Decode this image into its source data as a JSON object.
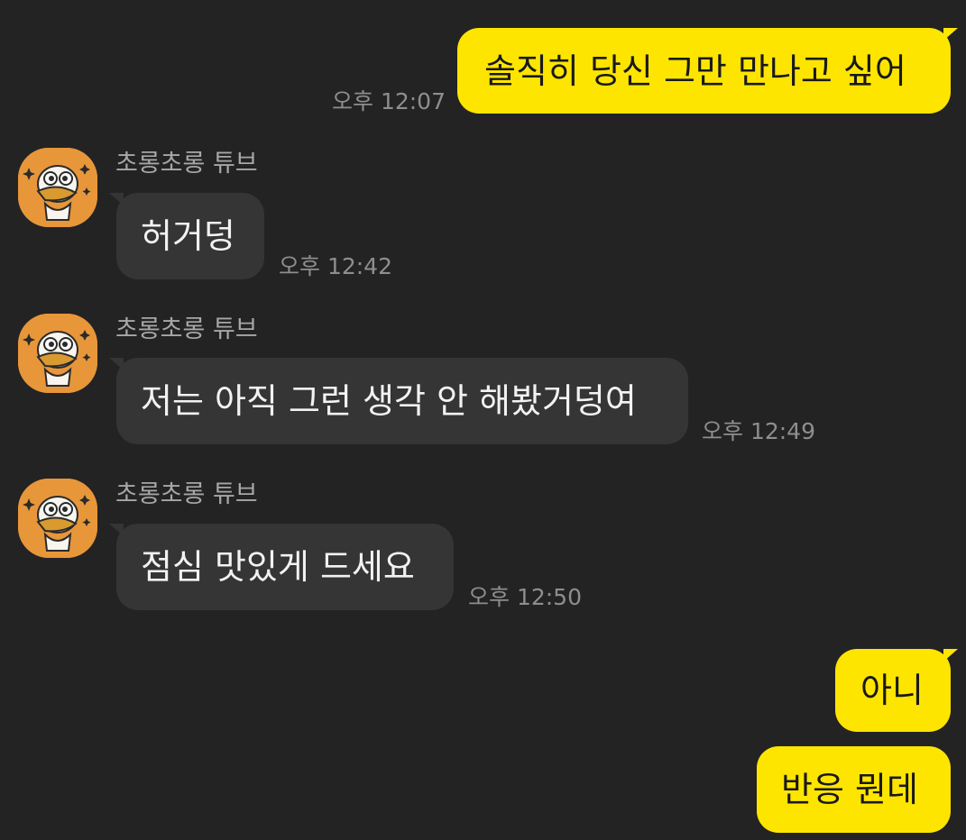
{
  "colors": {
    "background": "#232323",
    "my_bubble": "#FEE500",
    "their_bubble": "#353535",
    "avatar": "#E8963A"
  },
  "messages": [
    {
      "id": "m1",
      "side": "me",
      "text": "솔직히 당신 그만 만나고 싶어",
      "time": "오후 12:07"
    },
    {
      "id": "m2",
      "side": "them",
      "sender": "초롱초롱 튜브",
      "text": "허거덩",
      "time": "오후 12:42"
    },
    {
      "id": "m3",
      "side": "them",
      "sender": "초롱초롱 튜브",
      "text": "저는 아직 그런 생각 안 해봤거덩여",
      "time": "오후 12:49"
    },
    {
      "id": "m4",
      "side": "them",
      "sender": "초롱초롱 튜브",
      "text": "점심 맛있게 드세요",
      "time": "오후 12:50"
    },
    {
      "id": "m5",
      "side": "me",
      "text": "아니"
    },
    {
      "id": "m6",
      "side": "me",
      "text": "반응 뭔데"
    }
  ],
  "avatar_icon": "tube-duck-sparkle-icon"
}
